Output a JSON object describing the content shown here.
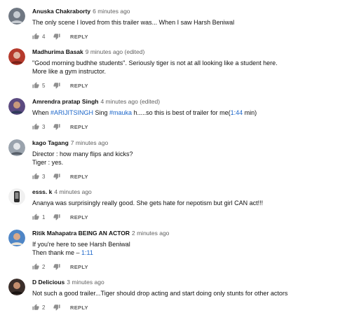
{
  "comments": [
    {
      "author": "Anuska Chakraborty",
      "time": "6 minutes ago",
      "text": [
        "The only scene I loved from this trailer was... When I saw Harsh Beniwal"
      ],
      "likes": "4",
      "reply_label": "REPLY",
      "avatar_color": "#6f7782"
    },
    {
      "author": "Madhurima Basak",
      "time": "9 minutes ago (edited)",
      "text": [
        "\"Good morning budhhe students\". Seriously tiger is not at all looking like a student here.",
        "More like a gym instructor."
      ],
      "likes": "5",
      "reply_label": "REPLY",
      "avatar_color": "#b53a2c"
    },
    {
      "author": "Amrendra pratap Singh",
      "time": "4 minutes ago (edited)",
      "text_parts": [
        {
          "t": "When ",
          "link": false
        },
        {
          "t": "#ARIJITSINGH",
          "link": true
        },
        {
          "t": " Sing ",
          "link": false
        },
        {
          "t": "#mauka",
          "link": true
        },
        {
          "t": " h.....so this is best of trailer for me(",
          "link": false
        },
        {
          "t": "1:44",
          "link": true
        },
        {
          "t": " min)",
          "link": false
        }
      ],
      "likes": "3",
      "reply_label": "REPLY",
      "avatar_color": "#5b4a80"
    },
    {
      "author": "kago Tagang",
      "time": "7 minutes ago",
      "text": [
        "Director : how many flips and kicks?",
        "Tiger : yes."
      ],
      "likes": "3",
      "reply_label": "REPLY",
      "avatar_color": "#9aa3ad"
    },
    {
      "author": "esss. k",
      "time": "4 minutes ago",
      "text": [
        "Ananya was surprisingly really good. She gets hate for nepotism but girl CAN act!!!"
      ],
      "likes": "1",
      "reply_label": "REPLY",
      "avatar_color": "#d8d8d8"
    },
    {
      "author": "Ritik Mahapatra BEING AN ACTOR",
      "time": "2 minutes ago",
      "text_lines_parts": [
        [
          {
            "t": "If you're here to see Harsh Beniwal",
            "link": false
          }
        ],
        [
          {
            "t": "Then thank me – ",
            "link": false
          },
          {
            "t": "1:11",
            "link": true
          }
        ]
      ],
      "likes": "2",
      "reply_label": "REPLY",
      "avatar_color": "#4f86c6"
    },
    {
      "author": "D Delicious",
      "time": "3 minutes ago",
      "text": [
        "Not such a good trailer...Tiger should drop acting and start doing only stunts for other actors"
      ],
      "likes": "2",
      "reply_label": "REPLY",
      "avatar_color": "#3b2e2a"
    }
  ]
}
